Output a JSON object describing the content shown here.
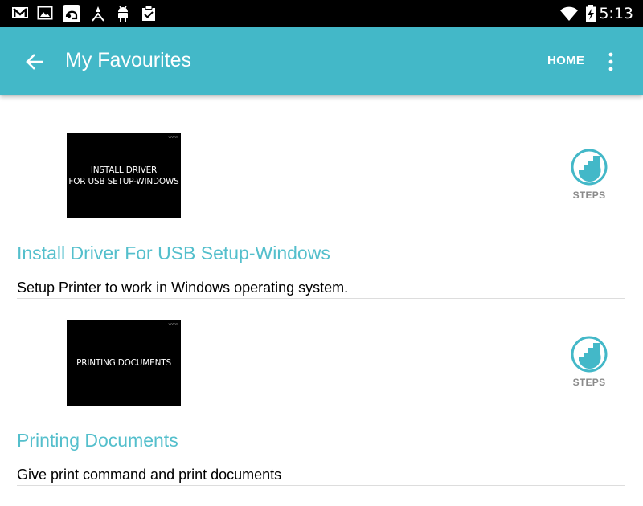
{
  "status_bar": {
    "time": "5:13",
    "left_icons": [
      "gmail-icon",
      "gallery-icon",
      "app-icon",
      "profile-icon",
      "android-debug-icon",
      "clipboard-check-icon"
    ],
    "right_icons": [
      "wifi-icon",
      "battery-charging-icon"
    ]
  },
  "app_bar": {
    "title": "My Favourites",
    "home_label": "HOME",
    "color": "#43b8c8"
  },
  "favourites": [
    {
      "thumbnail_lines": [
        "INSTALL DRIVER",
        "FOR USB SETUP-WINDOWS"
      ],
      "steps_label": "STEPS",
      "title": "Install Driver For USB Setup-Windows",
      "description": "Setup Printer to work in Windows operating system."
    },
    {
      "thumbnail_lines": [
        "PRINTING DOCUMENTS"
      ],
      "steps_label": "STEPS",
      "title": "Printing Documents",
      "description": "Give print command and print documents"
    }
  ],
  "colors": {
    "accent": "#43b8c8",
    "title_text": "#54bfcc",
    "steps_icon": "#43b8c8"
  }
}
